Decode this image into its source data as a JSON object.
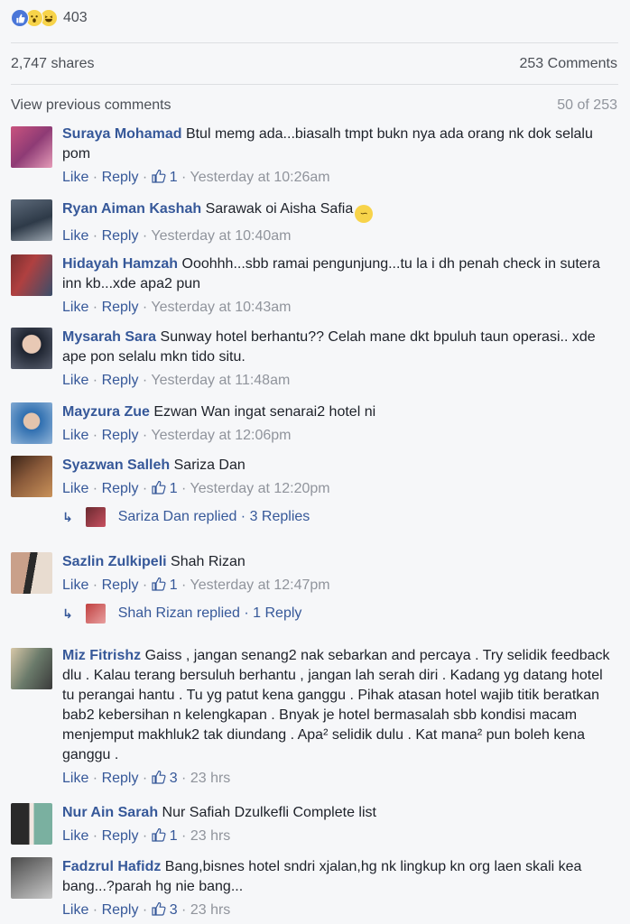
{
  "reactions": {
    "icons": [
      "like-reaction",
      "wow-reaction",
      "haha-reaction"
    ],
    "count": "403"
  },
  "stats": {
    "shares": "2,747 shares",
    "comments": "253 Comments"
  },
  "pager": {
    "view_previous": "View previous comments",
    "position": "50 of 253"
  },
  "meta_labels": {
    "like": "Like",
    "reply": "Reply",
    "sep": " · "
  },
  "comments": [
    {
      "author": "Suraya Mohamad",
      "text": "Btul memg ada...biasalh tmpt bukn nya ada orang nk dok selalu pom",
      "likes": "1",
      "time": "Yesterday at 10:26am"
    },
    {
      "author": "Ryan Aiman Kashah",
      "text": "Sarawak oi Aisha Safia",
      "likes": "",
      "time": "Yesterday at 10:40am"
    },
    {
      "author": "Hidayah Hamzah",
      "text": "Ooohhh...sbb ramai pengunjung...tu la i dh penah check in sutera inn kb...xde apa2 pun",
      "likes": "",
      "time": "Yesterday at 10:43am"
    },
    {
      "author": "Mysarah Sara",
      "text": "Sunway hotel berhantu?? Celah mane dkt bpuluh taun operasi.. xde ape pon selalu mkn tido situ.",
      "likes": "",
      "time": "Yesterday at 11:48am"
    },
    {
      "author": "Mayzura Zue",
      "text": "Ezwan Wan ingat senarai2 hotel ni",
      "likes": "",
      "time": "Yesterday at 12:06pm"
    },
    {
      "author": "Syazwan Salleh",
      "text": "Sariza Dan",
      "likes": "1",
      "time": "Yesterday at 12:20pm",
      "replies": "Sariza Dan replied · 3 Replies"
    },
    {
      "author": "Sazlin Zulkipeli",
      "text": "Shah Rizan",
      "likes": "1",
      "time": "Yesterday at 12:47pm",
      "replies": "Shah Rizan replied · 1 Reply"
    },
    {
      "author": "Miz Fitrishz",
      "text": "Gaiss , jangan senang2 nak sebarkan and percaya . Try selidik feedback dlu . Kalau terang bersuluh berhantu , jangan lah serah diri . Kadang yg datang hotel tu perangai hantu . Tu yg patut kena ganggu . Pihak atasan hotel wajib titik beratkan bab2 kebersihan n kelengkapan . Bnyak je hotel bermasalah sbb kondisi macam menjemput makhluk2 tak diundang . Apa² selidik dulu . Kat mana² pun boleh kena ganggu .",
      "likes": "3",
      "time": "23 hrs"
    },
    {
      "author": "Nur Ain Sarah",
      "text": "Nur Safiah Dzulkefli Complete list",
      "likes": "1",
      "time": "23 hrs"
    },
    {
      "author": "Fadzrul Hafidz",
      "text": "Bang,bisnes hotel sndri xjalan,hg nk lingkup kn org laen skali kea bang...?parah hg nie bang...",
      "likes": "3",
      "time": "23 hrs"
    }
  ]
}
